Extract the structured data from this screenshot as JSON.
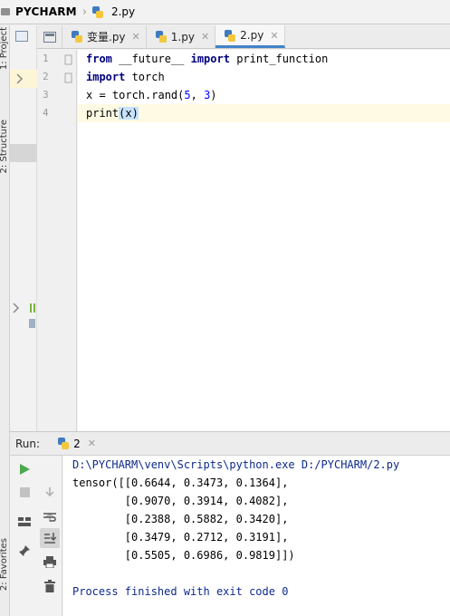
{
  "breadcrumb": {
    "project": "PYCHARM",
    "file": "2.py"
  },
  "side_tabs": {
    "project": "1: Project",
    "structure": "2: Structure",
    "favorites": "2: Favorites"
  },
  "tabs": [
    {
      "label": "变量.py",
      "active": false
    },
    {
      "label": "1.py",
      "active": false
    },
    {
      "label": "2.py",
      "active": true
    }
  ],
  "editor": {
    "line_numbers": [
      "1",
      "2",
      "3",
      "4"
    ],
    "lines": [
      {
        "parts": [
          {
            "t": "from",
            "c": "kw"
          },
          {
            "t": " __future__ ",
            "c": "fn"
          },
          {
            "t": "import",
            "c": "kw"
          },
          {
            "t": " print_function",
            "c": "fn"
          }
        ]
      },
      {
        "parts": [
          {
            "t": "import",
            "c": "kw"
          },
          {
            "t": " torch",
            "c": "fn"
          }
        ]
      },
      {
        "parts": [
          {
            "t": "x = torch.rand(",
            "c": "fn"
          },
          {
            "t": "5",
            "c": "num"
          },
          {
            "t": ", ",
            "c": "fn"
          },
          {
            "t": "3",
            "c": "num"
          },
          {
            "t": ")",
            "c": "fn"
          }
        ]
      },
      {
        "parts": [
          {
            "t": "print",
            "c": "fn"
          },
          {
            "t": "(x)",
            "c": "brace"
          }
        ]
      }
    ]
  },
  "run": {
    "label": "Run:",
    "tab_label": "2",
    "output": [
      {
        "text": "D:\\PYCHARM\\venv\\Scripts\\python.exe D:/PYCHARM/2.py",
        "kind": "cmd"
      },
      {
        "text": "tensor([[0.6644, 0.3473, 0.1364],",
        "kind": "std"
      },
      {
        "text": "        [0.9070, 0.3914, 0.4082],",
        "kind": "std"
      },
      {
        "text": "        [0.2388, 0.5882, 0.3420],",
        "kind": "std"
      },
      {
        "text": "        [0.3479, 0.2712, 0.3191],",
        "kind": "std"
      },
      {
        "text": "        [0.5505, 0.6986, 0.9819]])",
        "kind": "std"
      },
      {
        "text": "",
        "kind": "std"
      },
      {
        "text": "Process finished with exit code 0",
        "kind": "exit"
      }
    ]
  },
  "colors": {
    "keyword": "#000080",
    "number": "#0000ff",
    "console_system": "#0e2a8c",
    "active_tab_underline": "#4083c9",
    "current_line": "#fffae3"
  },
  "icons": {
    "run": "play-icon",
    "stop": "stop-icon",
    "layout": "layout-icon",
    "soft_wrap": "soft-wrap-icon",
    "scroll_end": "scroll-to-end-icon",
    "print": "print-icon",
    "clear": "trash-icon",
    "pin": "pin-icon"
  }
}
